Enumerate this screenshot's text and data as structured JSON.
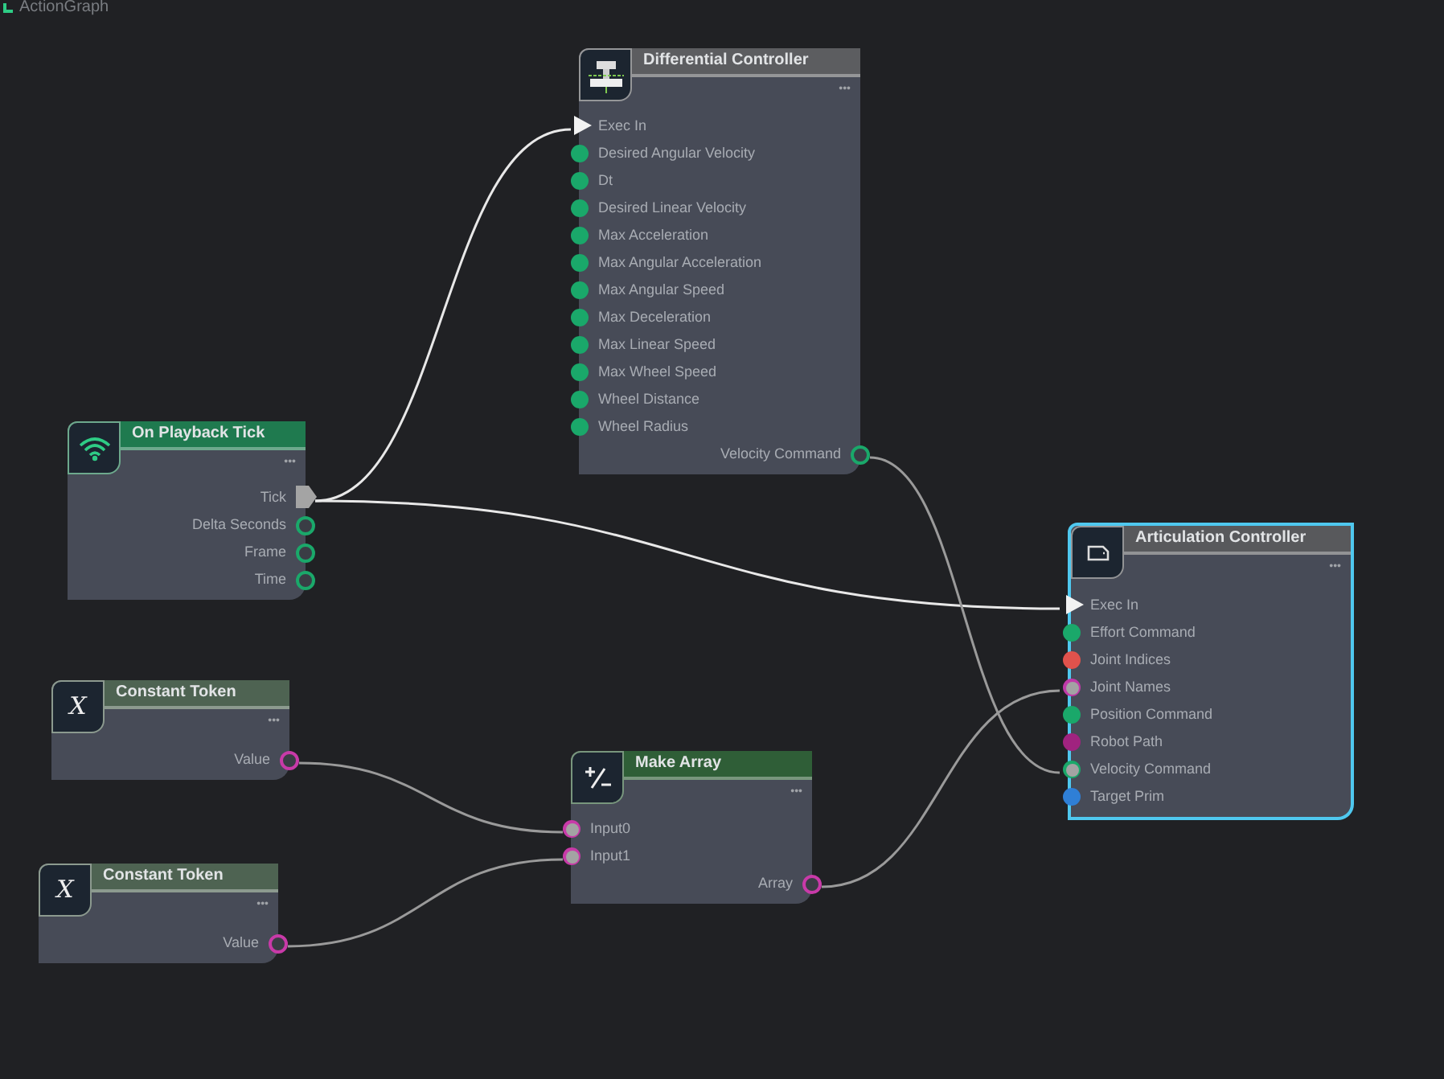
{
  "title": "ActionGraph",
  "nodes": [
    {
      "title": "Differential Controller",
      "color": "#5c5d60",
      "selected": false,
      "menu": "•••",
      "ports": [
        {
          "label": "Exec In",
          "kind": "execin"
        },
        {
          "label": "Desired Angular Velocity",
          "kind": "datain",
          "color": "#1aa86a",
          "connected": false
        },
        {
          "label": "Dt",
          "kind": "datain",
          "color": "#1aa86a",
          "connected": false
        },
        {
          "label": "Desired Linear Velocity",
          "kind": "datain",
          "color": "#1aa86a",
          "connected": false
        },
        {
          "label": "Max Acceleration",
          "kind": "datain",
          "color": "#1aa86a",
          "connected": false
        },
        {
          "label": "Max Angular Acceleration",
          "kind": "datain",
          "color": "#1aa86a",
          "connected": false
        },
        {
          "label": "Max Angular Speed",
          "kind": "datain",
          "color": "#1aa86a",
          "connected": false
        },
        {
          "label": "Max Deceleration",
          "kind": "datain",
          "color": "#1aa86a",
          "connected": false
        },
        {
          "label": "Max Linear Speed",
          "kind": "datain",
          "color": "#1aa86a",
          "connected": false
        },
        {
          "label": "Max Wheel Speed",
          "kind": "datain",
          "color": "#1aa86a",
          "connected": false
        },
        {
          "label": "Wheel Distance",
          "kind": "datain",
          "color": "#1aa86a",
          "connected": false
        },
        {
          "label": "Wheel Radius",
          "kind": "datain",
          "color": "#1aa86a",
          "connected": false
        },
        {
          "label": "Velocity Command",
          "kind": "dataout",
          "color": "#1aa86a"
        }
      ]
    },
    {
      "title": "On Playback Tick",
      "color": "#1f7a4f",
      "selected": false,
      "menu": "•••",
      "ports": [
        {
          "label": "Tick",
          "kind": "execout"
        },
        {
          "label": "Delta Seconds",
          "kind": "dataout",
          "color": "#1aa86a"
        },
        {
          "label": "Frame",
          "kind": "dataout",
          "color": "#1aa86a"
        },
        {
          "label": "Time",
          "kind": "dataout",
          "color": "#1aa86a"
        }
      ]
    },
    {
      "title": "Articulation Controller",
      "color": "#58595c",
      "selected": true,
      "menu": "•••",
      "ports": [
        {
          "label": "Exec In",
          "kind": "execin"
        },
        {
          "label": "Effort Command",
          "kind": "datain",
          "color": "#1aa86a",
          "connected": false
        },
        {
          "label": "Joint Indices",
          "kind": "datain",
          "color": "#e0524c",
          "connected": false
        },
        {
          "label": "Joint Names",
          "kind": "datain",
          "color": "#c03aa8",
          "connected": true
        },
        {
          "label": "Position Command",
          "kind": "datain",
          "color": "#1aa86a",
          "connected": false
        },
        {
          "label": "Robot Path",
          "kind": "datain",
          "color": "#a0237f",
          "connected": false
        },
        {
          "label": "Velocity Command",
          "kind": "datain",
          "color": "#1aa86a",
          "connected": true
        },
        {
          "label": "Target Prim",
          "kind": "datain",
          "color": "#2f7fd6",
          "connected": false
        }
      ]
    },
    {
      "title": "Constant Token",
      "icon_text": "X",
      "color": "#4e6352",
      "selected": false,
      "menu": "•••",
      "ports": [
        {
          "label": "Value",
          "kind": "dataout",
          "color": "#c83aa8"
        }
      ]
    },
    {
      "title": "Make Array",
      "color": "#2f5e37",
      "selected": false,
      "menu": "•••",
      "ports": [
        {
          "label": "Input0",
          "kind": "datain",
          "color": "#c83aa8",
          "connected": true
        },
        {
          "label": "Input1",
          "kind": "datain",
          "color": "#c83aa8",
          "connected": true
        },
        {
          "label": "Array",
          "kind": "dataout",
          "color": "#c83aa8"
        }
      ]
    },
    {
      "title": "Constant Token",
      "icon_text": "X",
      "color": "#4e6352",
      "selected": false,
      "menu": "•••",
      "ports": [
        {
          "label": "Value",
          "kind": "dataout",
          "color": "#c83aa8"
        }
      ]
    }
  ]
}
